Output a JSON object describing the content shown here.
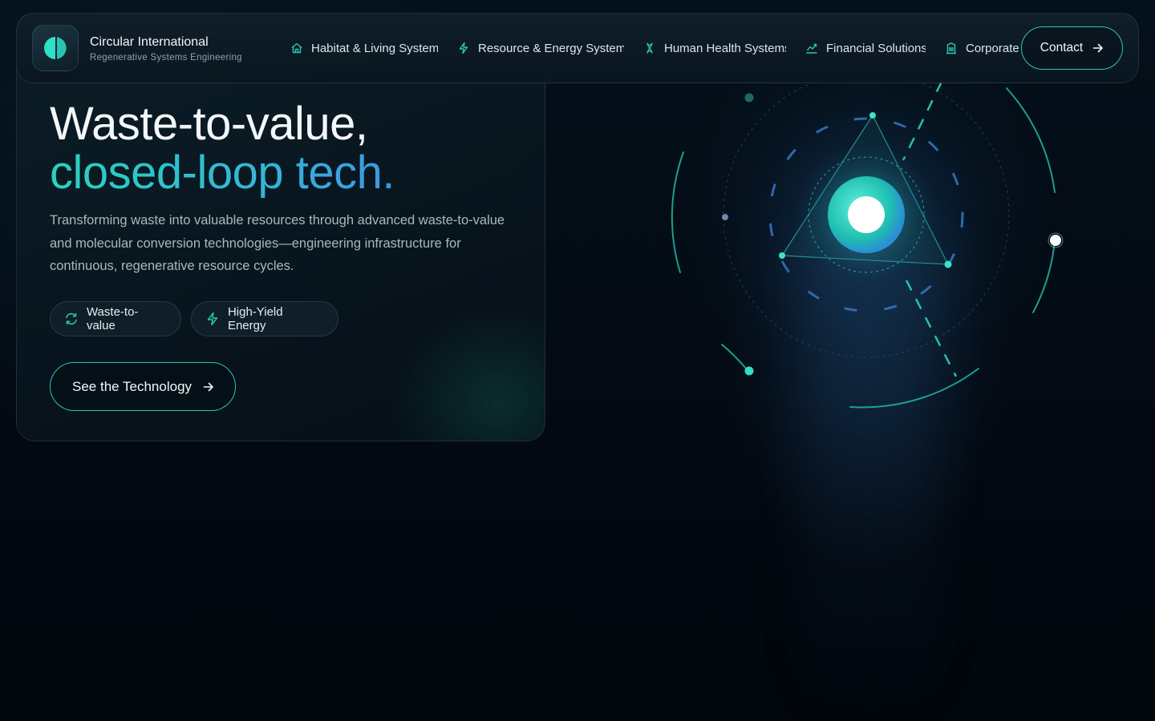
{
  "brand": {
    "name": "Circular International",
    "tagline": "Regenerative Systems Engineering"
  },
  "nav": {
    "items": [
      {
        "label": "Habitat & Living System",
        "icon": "home-icon"
      },
      {
        "label": "Resource & Energy System",
        "icon": "bolt-icon"
      },
      {
        "label": "Human Health Systems",
        "icon": "dna-icon"
      },
      {
        "label": "Financial Solutions",
        "icon": "chart-icon"
      },
      {
        "label": "Corporate",
        "icon": "building-icon"
      }
    ],
    "contact_label": "Contact"
  },
  "hero": {
    "headline_line1": "Waste-to-value,",
    "headline_line2": "closed-loop tech.",
    "description": "Transforming waste into valuable resources through advanced waste-to-value and molecular conversion technologies—engineering infrastructure for continuous, regenerative resource cycles.",
    "tags": [
      {
        "label": "Waste-to-value",
        "icon": "recycle-icon"
      },
      {
        "label": "High-Yield Energy",
        "icon": "bolt-icon"
      }
    ],
    "cta_label": "See the Technology"
  },
  "colors": {
    "accent_teal": "#2bc9b4",
    "accent_blue": "#3c96e0",
    "background": "#030a12"
  }
}
